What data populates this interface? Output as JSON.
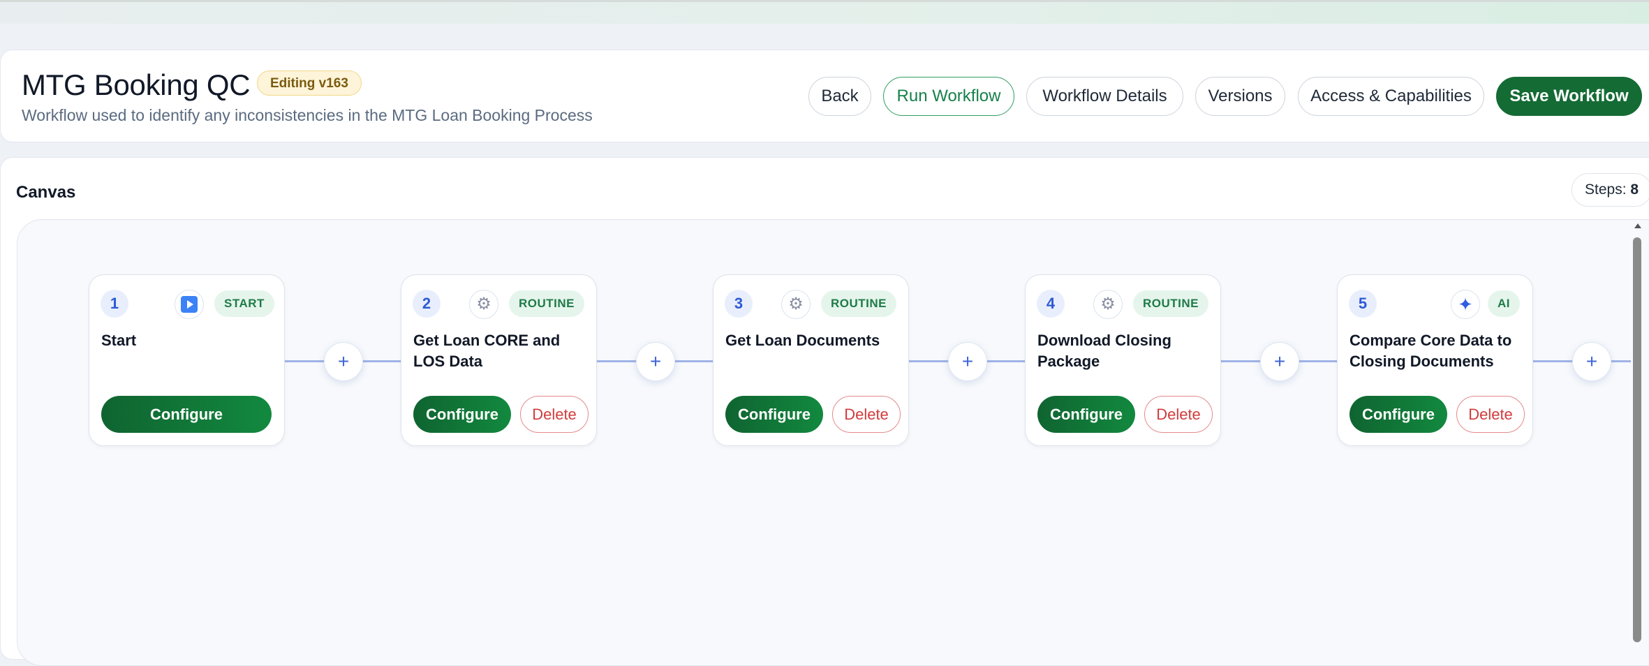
{
  "header": {
    "title": "MTG Booking QC",
    "edit_badge": "Editing v163",
    "subtitle": "Workflow used to identify any inconsistencies in the MTG Loan Booking Process",
    "buttons": {
      "back": "Back",
      "run": "Run Workflow",
      "details": "Workflow Details",
      "versions": "Versions",
      "access": "Access & Capabilities",
      "save": "Save Workflow"
    }
  },
  "canvas": {
    "title": "Canvas",
    "steps_label": "Steps:",
    "steps_count": "8",
    "add_symbol": "+",
    "configure_label": "Configure",
    "delete_label": "Delete",
    "steps": [
      {
        "number": "1",
        "type": "START",
        "icon": "play-icon",
        "title": "Start"
      },
      {
        "number": "2",
        "type": "ROUTINE",
        "icon": "gear-icon",
        "title": "Get Loan CORE and LOS Data"
      },
      {
        "number": "3",
        "type": "ROUTINE",
        "icon": "gear-icon",
        "title": "Get Loan Documents"
      },
      {
        "number": "4",
        "type": "ROUTINE",
        "icon": "gear-icon",
        "title": "Download Closing Package"
      },
      {
        "number": "5",
        "type": "AI",
        "icon": "sparkle-icon",
        "title": "Compare Core Data to Closing Documents"
      }
    ]
  },
  "colors": {
    "accent_green": "#146b34",
    "start_badge_bg": "#e5f5ec",
    "step_number": "#2e5ad6",
    "delete_red": "#d23b3b",
    "edit_badge_bg": "#fdf4d9"
  }
}
